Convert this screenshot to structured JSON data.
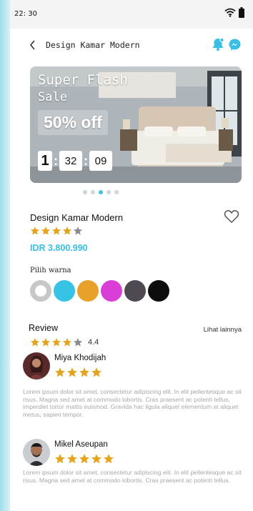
{
  "status_bar": {
    "time": "22: 30"
  },
  "header": {
    "title": "Design Kamar Modern"
  },
  "banner": {
    "promo_line1": "Super Flash",
    "promo_line2": "Sale",
    "discount": "50% off",
    "countdown": {
      "hours": "1",
      "minutes": "32",
      "seconds": "09"
    },
    "slide_count": 5,
    "active_slide": 2
  },
  "product": {
    "name": "Design Kamar Modern",
    "rating": 4,
    "rating_max": 5,
    "price": "IDR 3.800.990"
  },
  "colors": {
    "label": "Pilih warna",
    "options": [
      "#c7c7c7",
      "#36c3e6",
      "#e8a22b",
      "#d93fd6",
      "#4f4a52",
      "#0d0d0d"
    ],
    "selected_index": 0
  },
  "review": {
    "title": "Review",
    "see_more": "Lihat lainnya",
    "rating": 4,
    "rating_max": 5,
    "score": "4.4",
    "items": [
      {
        "name": "Miya Khodijah",
        "stars": 4,
        "text": "Lorem ipsum dolor sit amet, consectetur adipiscing elit. In elit pellentesque ac sit risus. Magna sed amet at commodo lobortis. Cras praesent ac potenti tellus, imperdiet tortor mattis euismod. Gravida hac ligula aliquet elementum at aliquet metus, sapien tempor."
      },
      {
        "name": "Mikel Aseupan",
        "stars": 5,
        "text": "Lorem ipsum dolor sit amet, consectetur adipiscing elit. In elit pellentesque ac sit risus. Magna sed amet at commodo lobortis. Cras praesent ac potenti tellus."
      }
    ]
  },
  "theme": {
    "accent": "#38bfe3",
    "star_filled": "#e3a520",
    "star_empty": "#8c8c8c"
  },
  "icons": {
    "back": "chevron-left-icon",
    "notification": "bell-icon",
    "messenger": "messenger-icon",
    "favorite": "heart-outline-icon",
    "wifi": "wifi-icon",
    "battery": "battery-icon"
  }
}
